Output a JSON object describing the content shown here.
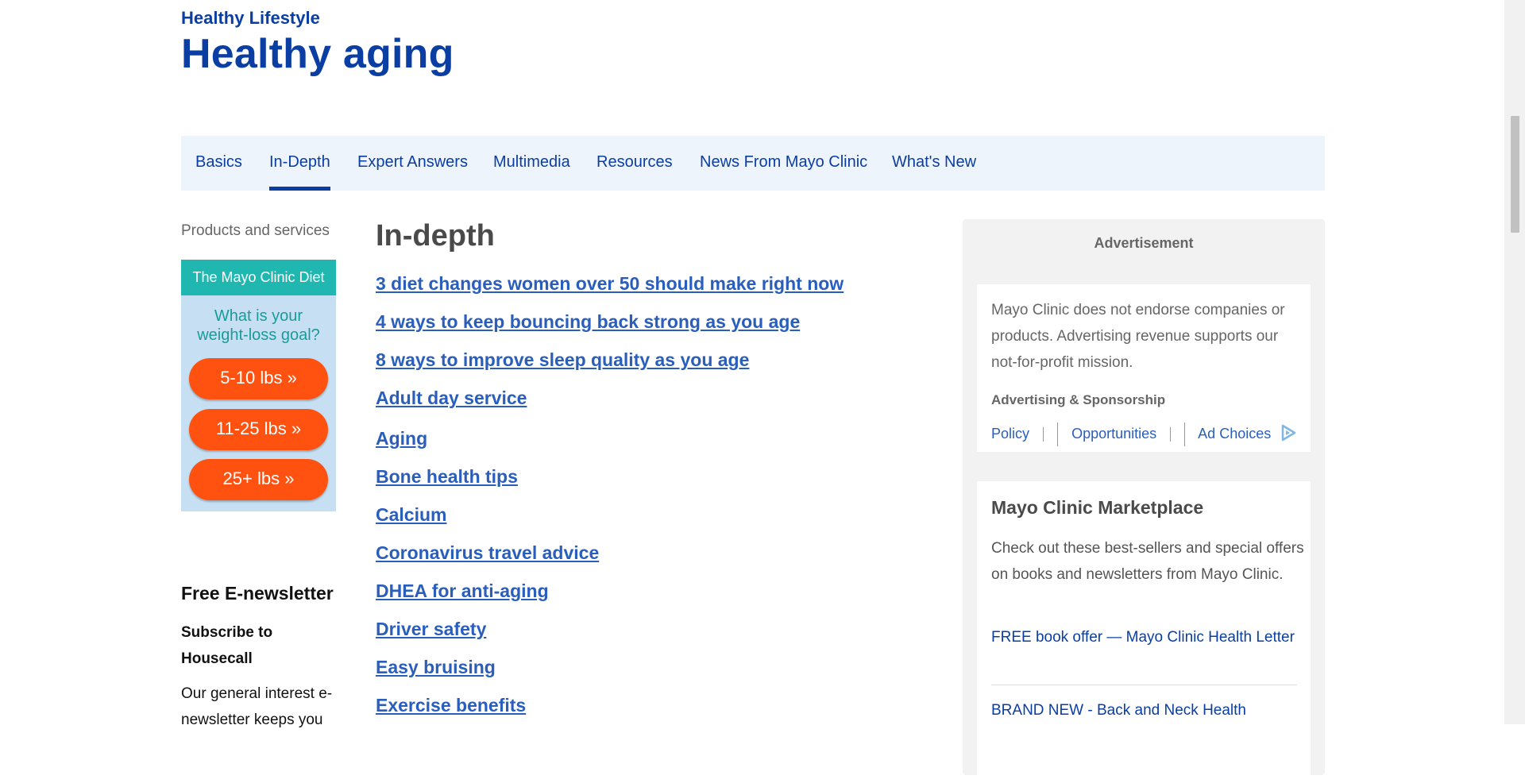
{
  "header": {
    "eyebrow": "Healthy Lifestyle",
    "title": "Healthy aging"
  },
  "tabs": [
    {
      "label": "Basics",
      "active": false
    },
    {
      "label": "In-Depth",
      "active": true
    },
    {
      "label": "Expert Answers",
      "active": false
    },
    {
      "label": "Multimedia",
      "active": false
    },
    {
      "label": "Resources",
      "active": false
    },
    {
      "label": "News From Mayo Clinic",
      "active": false
    },
    {
      "label": "What's New",
      "active": false
    }
  ],
  "left": {
    "products_label": "Products and services",
    "diet_ad": {
      "header": "The Mayo Clinic Diet",
      "question": "What is your weight-loss goal?",
      "buttons": [
        "5-10 lbs »",
        "11-25 lbs »",
        "25+ lbs »"
      ]
    },
    "newsletter": {
      "title": "Free E-newsletter",
      "subtitle": "Subscribe to Housecall",
      "description": "Our general interest e-newsletter keeps you"
    }
  },
  "main": {
    "heading": "In-depth",
    "links": [
      "3 diet changes women over 50 should make right now",
      "4 ways to keep bouncing back strong as you age",
      "8 ways to improve sleep quality as you age",
      "Adult day service",
      "Aging",
      "Bone health tips",
      "Calcium",
      "Coronavirus travel advice",
      "DHEA for anti-aging",
      "Driver safety",
      "Easy bruising",
      "Exercise benefits"
    ]
  },
  "right": {
    "ad_label": "Advertisement",
    "ad_disclaimer": "Mayo Clinic does not endorse companies or products. Advertising revenue supports our not-for-profit mission.",
    "ad_sponsor_title": "Advertising & Sponsorship",
    "ad_links": {
      "policy": "Policy",
      "opportunities": "Opportunities",
      "ad_choices": "Ad Choices"
    },
    "marketplace": {
      "title": "Mayo Clinic Marketplace",
      "description": "Check out these best-sellers and special offers on books and newsletters from Mayo Clinic.",
      "link1": "FREE book offer — Mayo Clinic Health Letter",
      "link2": "BRAND NEW - Back and Neck Health"
    }
  },
  "colors": {
    "brand_blue": "#0a3ea3",
    "link_blue": "#2a5ebd",
    "tab_bg": "#eef4fc",
    "diet_teal": "#20b7b0",
    "diet_orange": "#ff5210"
  }
}
